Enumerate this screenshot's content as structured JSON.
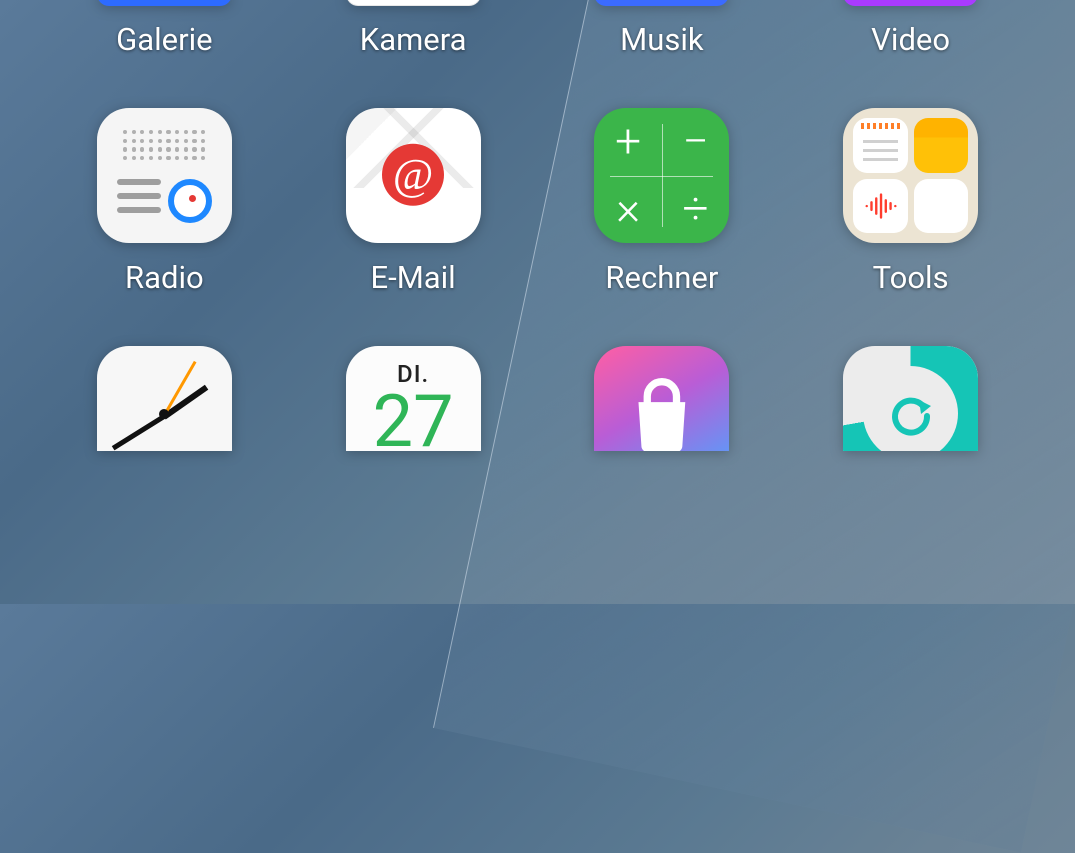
{
  "apps": {
    "row0": [
      {
        "label": "Galerie",
        "icon": "galerie",
        "iconColor": "#2d6bff"
      },
      {
        "label": "Kamera",
        "icon": "kamera",
        "iconColor": "#fff"
      },
      {
        "label": "Musik",
        "icon": "musik",
        "iconColor": "#3b6bff"
      },
      {
        "label": "Video",
        "icon": "video",
        "iconColor": "#a93bff"
      }
    ],
    "row1": [
      {
        "label": "Radio",
        "icon": "radio"
      },
      {
        "label": "E-Mail",
        "icon": "email"
      },
      {
        "label": "Rechner",
        "icon": "calculator"
      },
      {
        "label": "Tools",
        "icon": "tools-folder"
      }
    ],
    "row2": [
      {
        "label": "",
        "icon": "clock"
      },
      {
        "label": "",
        "icon": "calendar",
        "calendarDay": "DI.",
        "calendarDate": "27"
      },
      {
        "label": "",
        "icon": "store"
      },
      {
        "label": "",
        "icon": "backup"
      }
    ]
  }
}
